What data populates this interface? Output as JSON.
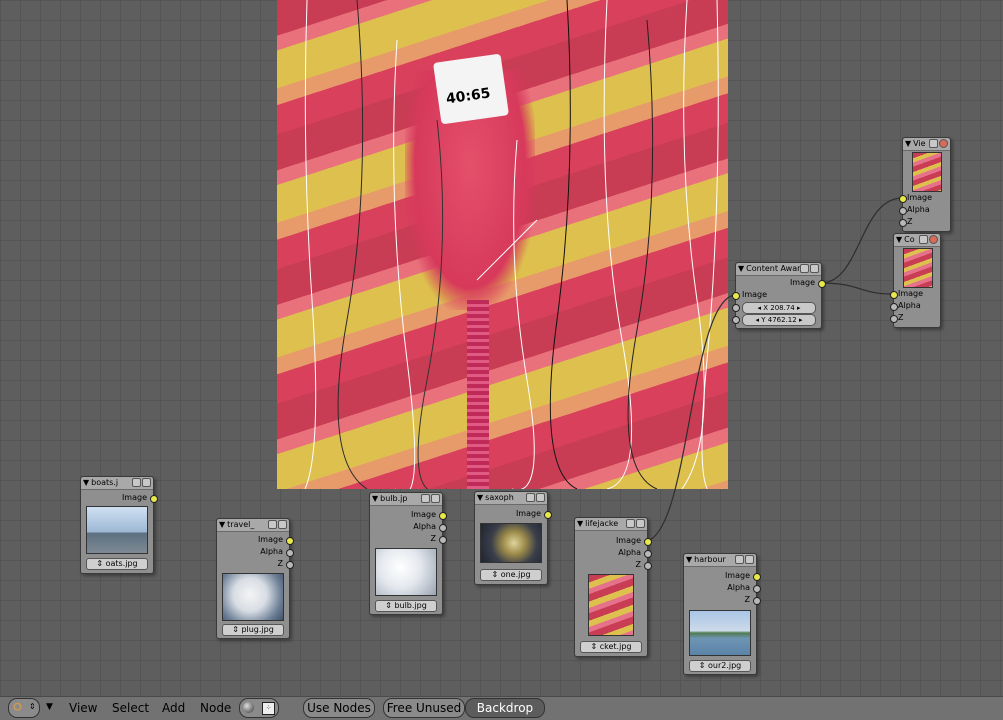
{
  "toolbar": {
    "menus": [
      "View",
      "Select",
      "Add",
      "Node"
    ],
    "use_nodes_label": "Use Nodes",
    "free_unused_label": "Free Unused",
    "backdrop_label": "Backdrop"
  },
  "backdrop": {
    "tag_text": "40:65"
  },
  "nodes": {
    "boats": {
      "title": "boats.j",
      "outputs": [
        "Image"
      ],
      "file": "oats.jpg"
    },
    "travel": {
      "title": "travel_",
      "outputs": [
        "Image",
        "Alpha",
        "Z"
      ],
      "file": "plug.jpg"
    },
    "bulb": {
      "title": "bulb.jp",
      "outputs": [
        "Image",
        "Alpha",
        "Z"
      ],
      "file": "bulb.jpg"
    },
    "saxophone": {
      "title": "saxoph",
      "outputs": [
        "Image"
      ],
      "file": "one.jpg"
    },
    "lifejacket": {
      "title": "lifejacke",
      "outputs": [
        "Image",
        "Alpha",
        "Z"
      ],
      "file": "cket.jpg"
    },
    "harbour": {
      "title": "harbour",
      "outputs": [
        "Image",
        "Alpha",
        "Z"
      ],
      "file": "our2.jpg"
    },
    "content_aware": {
      "title": "Content Awar",
      "output": "Image",
      "input": "Image",
      "x_field": "X 208.74",
      "y_field": "Y 4762.12"
    },
    "viewer": {
      "title": "Vie",
      "inputs": [
        "Image",
        "Alpha",
        "Z"
      ]
    },
    "composite": {
      "title": "Co",
      "inputs": [
        "Image",
        "Alpha",
        "Z"
      ]
    }
  },
  "colors": {
    "socket_image": "#e8e84a",
    "socket_other": "#b8b8b8",
    "node_body": "#8f8f8f"
  }
}
